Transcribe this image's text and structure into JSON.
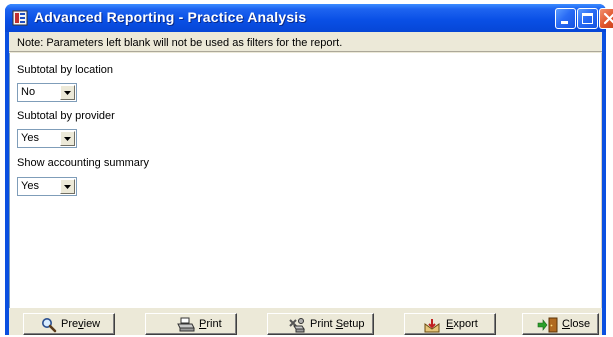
{
  "window": {
    "title": "Advanced Reporting - Practice Analysis",
    "controls": [
      "minimize-icon",
      "maximize-icon",
      "close-icon"
    ]
  },
  "note": "Note: Parameters left blank will not be used as filters for the report.",
  "params": [
    {
      "label": "Subtotal by location",
      "value": "No"
    },
    {
      "label": "Subtotal by provider",
      "value": "Yes"
    },
    {
      "label": "Show accounting summary",
      "value": "Yes"
    }
  ],
  "buttons": {
    "preview": {
      "pre": "Pre",
      "key": "v",
      "post": "iew",
      "icon": "magnifier-icon"
    },
    "print": {
      "pre": "",
      "key": "P",
      "post": "rint",
      "icon": "printer-icon"
    },
    "print_setup": {
      "pre": "Print ",
      "key": "S",
      "post": "etup",
      "icon": "printer-setup-icon"
    },
    "export": {
      "pre": "",
      "key": "E",
      "post": "xport",
      "icon": "export-icon"
    },
    "close": {
      "pre": "",
      "key": "C",
      "post": "lose",
      "icon": "exit-door-icon"
    }
  },
  "colors": {
    "titlebar": "#0a50e6",
    "face": "#ece9d8",
    "close_button": "#e1562e"
  }
}
